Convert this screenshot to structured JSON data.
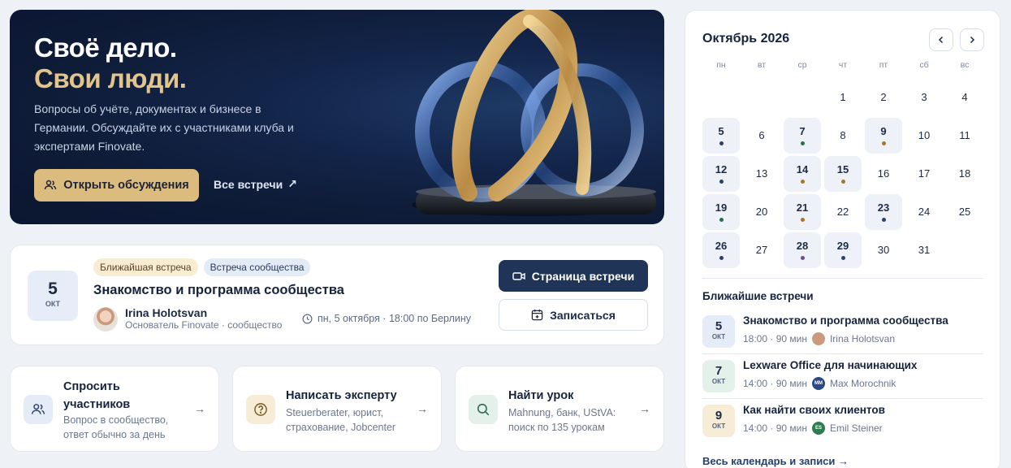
{
  "hero": {
    "title_line1": "Своё дело.",
    "title_line2": "Свои люди.",
    "description": "Вопросы об учёте, документах и бизнесе в Германии. Обсуждайте их с участниками клуба и экспертами Finovate.",
    "primary_button": "Открыть обсуждения",
    "secondary_link": "Все встречи",
    "link_arrow": "↗"
  },
  "meeting": {
    "date_num": "5",
    "date_month": "ОКТ",
    "tag_next": "Ближайшая встреча",
    "tag_type": "Встреча сообщества",
    "title": "Знакомство и программа сообщества",
    "host_name": "Irina Holotsvan",
    "host_role": "Основатель Finovate · сообщество",
    "time": "пн, 5 октября · 18:00  по Берлину",
    "page_button": "Страница встречи",
    "signup_button": "Записаться"
  },
  "actions": [
    {
      "title": "Спросить участников",
      "desc": "Вопрос в сообщество, ответ обычно за день",
      "icon": "users-icon",
      "icon_bg": "#e5ecf7"
    },
    {
      "title": "Написать эксперту",
      "desc": "Steuerberater, юрист, страхование, Jobcenter",
      "icon": "question-icon",
      "icon_bg": "#f7ecd5"
    },
    {
      "title": "Найти урок",
      "desc": "Mahnung, банк, UStVA: поиск по 135 урокам",
      "icon": "search-icon",
      "icon_bg": "#e3f1ea"
    }
  ],
  "calendar": {
    "title": "Октябрь 2026",
    "weekdays": [
      "пн",
      "вт",
      "ср",
      "чт",
      "пт",
      "сб",
      "вс"
    ],
    "days": [
      {
        "n": "1"
      },
      {
        "n": "2"
      },
      {
        "n": "3"
      },
      {
        "n": "4"
      },
      {
        "n": "5",
        "dot": "#2c4166"
      },
      {
        "n": "6"
      },
      {
        "n": "7",
        "dot": "#2e6b52"
      },
      {
        "n": "8"
      },
      {
        "n": "9",
        "dot": "#a9742c"
      },
      {
        "n": "10"
      },
      {
        "n": "11"
      },
      {
        "n": "12",
        "dot": "#2c4166"
      },
      {
        "n": "13"
      },
      {
        "n": "14",
        "dot": "#a9742c"
      },
      {
        "n": "15",
        "dot": "#a9742c"
      },
      {
        "n": "16"
      },
      {
        "n": "17"
      },
      {
        "n": "18"
      },
      {
        "n": "19",
        "dot": "#2e6b52"
      },
      {
        "n": "20"
      },
      {
        "n": "21",
        "dot": "#a9742c"
      },
      {
        "n": "22"
      },
      {
        "n": "23",
        "dot": "#2c4166"
      },
      {
        "n": "24"
      },
      {
        "n": "25"
      },
      {
        "n": "26",
        "dot": "#2c4166"
      },
      {
        "n": "27"
      },
      {
        "n": "28",
        "dot": "#6a4e8a"
      },
      {
        "n": "29",
        "dot": "#2c4166"
      },
      {
        "n": "30"
      },
      {
        "n": "31"
      }
    ],
    "upcoming_title": "Ближайшие встречи",
    "upcoming": [
      {
        "num": "5",
        "mon": "ОКТ",
        "title": "Знакомство и программа сообщества",
        "meta": "18:00 · 90 мин",
        "person": "Irina Holotsvan",
        "initials": "",
        "bg": "#e5ecf7",
        "av": "#c99a7d"
      },
      {
        "num": "7",
        "mon": "ОКТ",
        "title": "Lexware Office для начинающих",
        "meta": "14:00 · 90 мин",
        "person": "Max Morochnik",
        "initials": "MM",
        "bg": "#e3f1ea",
        "av": "#2a4a86"
      },
      {
        "num": "9",
        "mon": "ОКТ",
        "title": "Как найти своих клиентов",
        "meta": "14:00 · 90 мин",
        "person": "Emil Steiner",
        "initials": "ES",
        "bg": "#f7ecd5",
        "av": "#2e7d4f"
      }
    ],
    "footer_link": "Весь календарь и записи",
    "footer_arrow": "→"
  }
}
